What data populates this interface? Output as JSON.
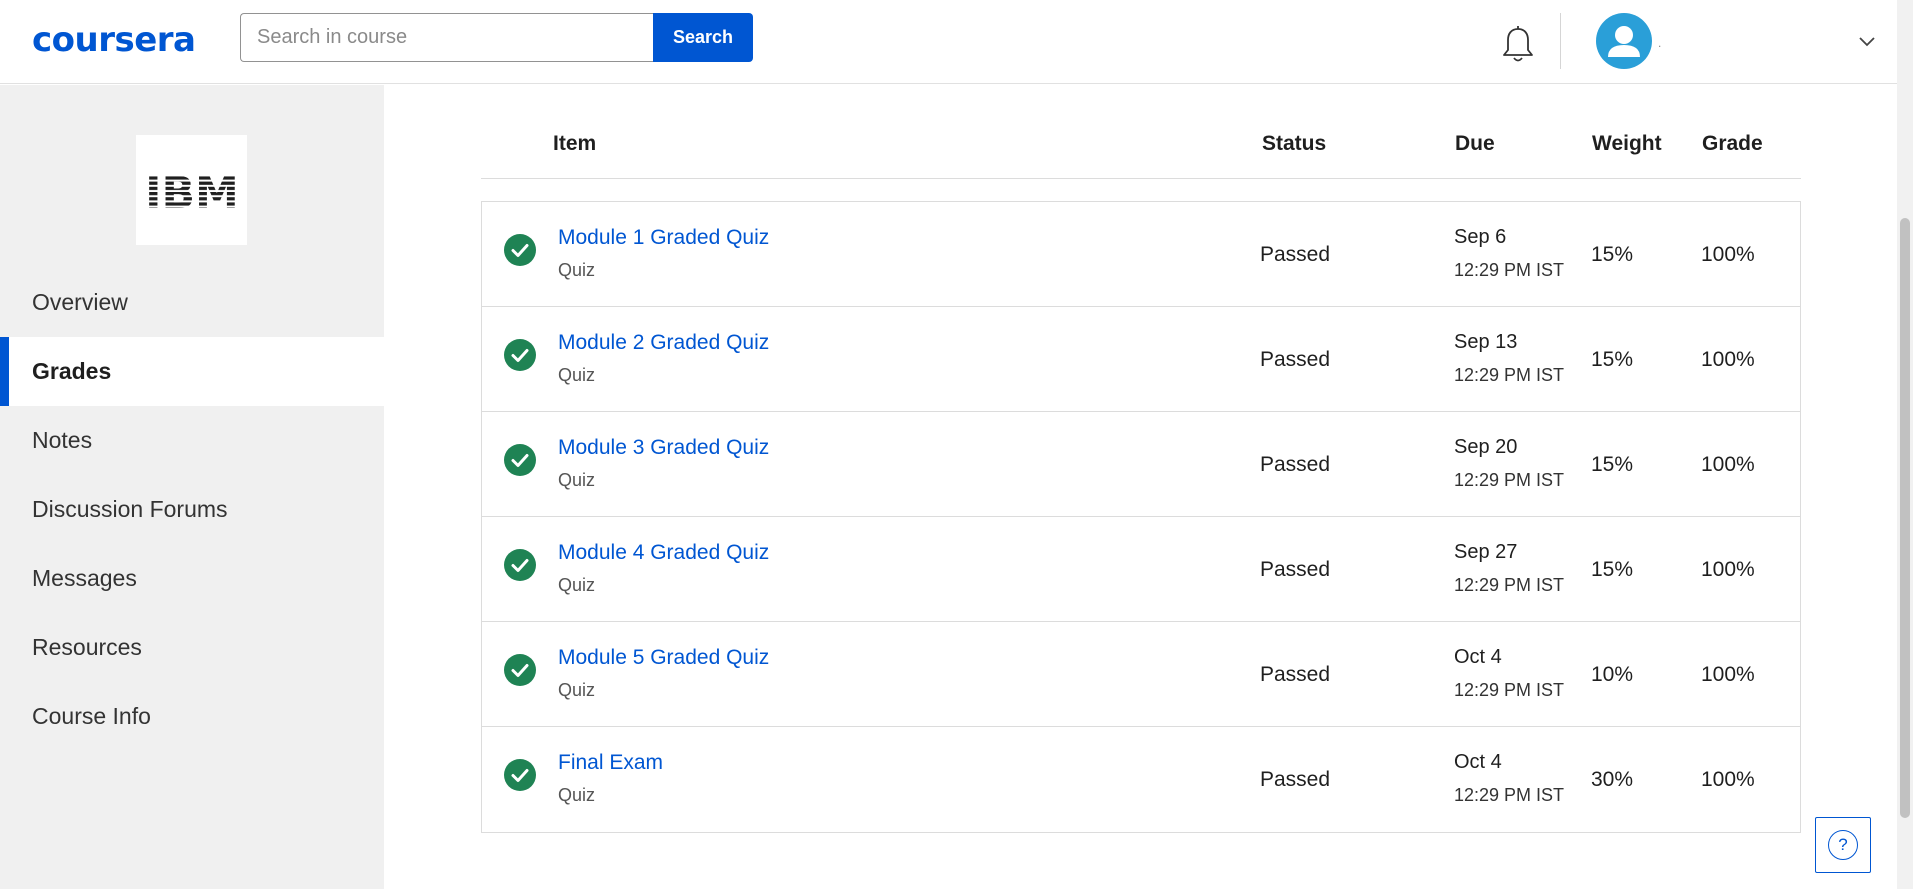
{
  "header": {
    "logo_text": "coursera",
    "search_placeholder": "Search in course",
    "search_button": "Search",
    "user_name": "."
  },
  "sidebar": {
    "brand": "IBM",
    "items": [
      {
        "label": "Overview",
        "active": false
      },
      {
        "label": "Grades",
        "active": true
      },
      {
        "label": "Notes",
        "active": false
      },
      {
        "label": "Discussion Forums",
        "active": false
      },
      {
        "label": "Messages",
        "active": false
      },
      {
        "label": "Resources",
        "active": false
      },
      {
        "label": "Course Info",
        "active": false
      }
    ]
  },
  "grades": {
    "columns": {
      "item": "Item",
      "status": "Status",
      "due": "Due",
      "weight": "Weight",
      "grade": "Grade"
    },
    "rows": [
      {
        "title": "Module 1 Graded Quiz",
        "type": "Quiz",
        "status": "Passed",
        "due_date": "Sep 6",
        "due_time": "12:29 PM IST",
        "weight": "15%",
        "grade": "100%"
      },
      {
        "title": "Module 2 Graded Quiz",
        "type": "Quiz",
        "status": "Passed",
        "due_date": "Sep 13",
        "due_time": "12:29 PM IST",
        "weight": "15%",
        "grade": "100%"
      },
      {
        "title": "Module 3 Graded Quiz",
        "type": "Quiz",
        "status": "Passed",
        "due_date": "Sep 20",
        "due_time": "12:29 PM IST",
        "weight": "15%",
        "grade": "100%"
      },
      {
        "title": "Module 4 Graded Quiz",
        "type": "Quiz",
        "status": "Passed",
        "due_date": "Sep 27",
        "due_time": "12:29 PM IST",
        "weight": "15%",
        "grade": "100%"
      },
      {
        "title": "Module 5 Graded Quiz",
        "type": "Quiz",
        "status": "Passed",
        "due_date": "Oct 4",
        "due_time": "12:29 PM IST",
        "weight": "10%",
        "grade": "100%"
      },
      {
        "title": "Final Exam",
        "type": "Quiz",
        "status": "Passed",
        "due_date": "Oct 4",
        "due_time": "12:29 PM IST",
        "weight": "30%",
        "grade": "100%"
      }
    ]
  },
  "help": {
    "icon_text": "?"
  },
  "icons": {
    "bell": "bell-icon",
    "avatar": "user-avatar-icon",
    "chevron": "chevron-down-icon",
    "check": "check-circle-icon",
    "help": "help-icon"
  },
  "colors": {
    "brand_blue": "#0056d2",
    "success_green": "#1f8354",
    "avatar_blue": "#2a9fd8",
    "sidebar_bg": "#f0f0f0"
  }
}
